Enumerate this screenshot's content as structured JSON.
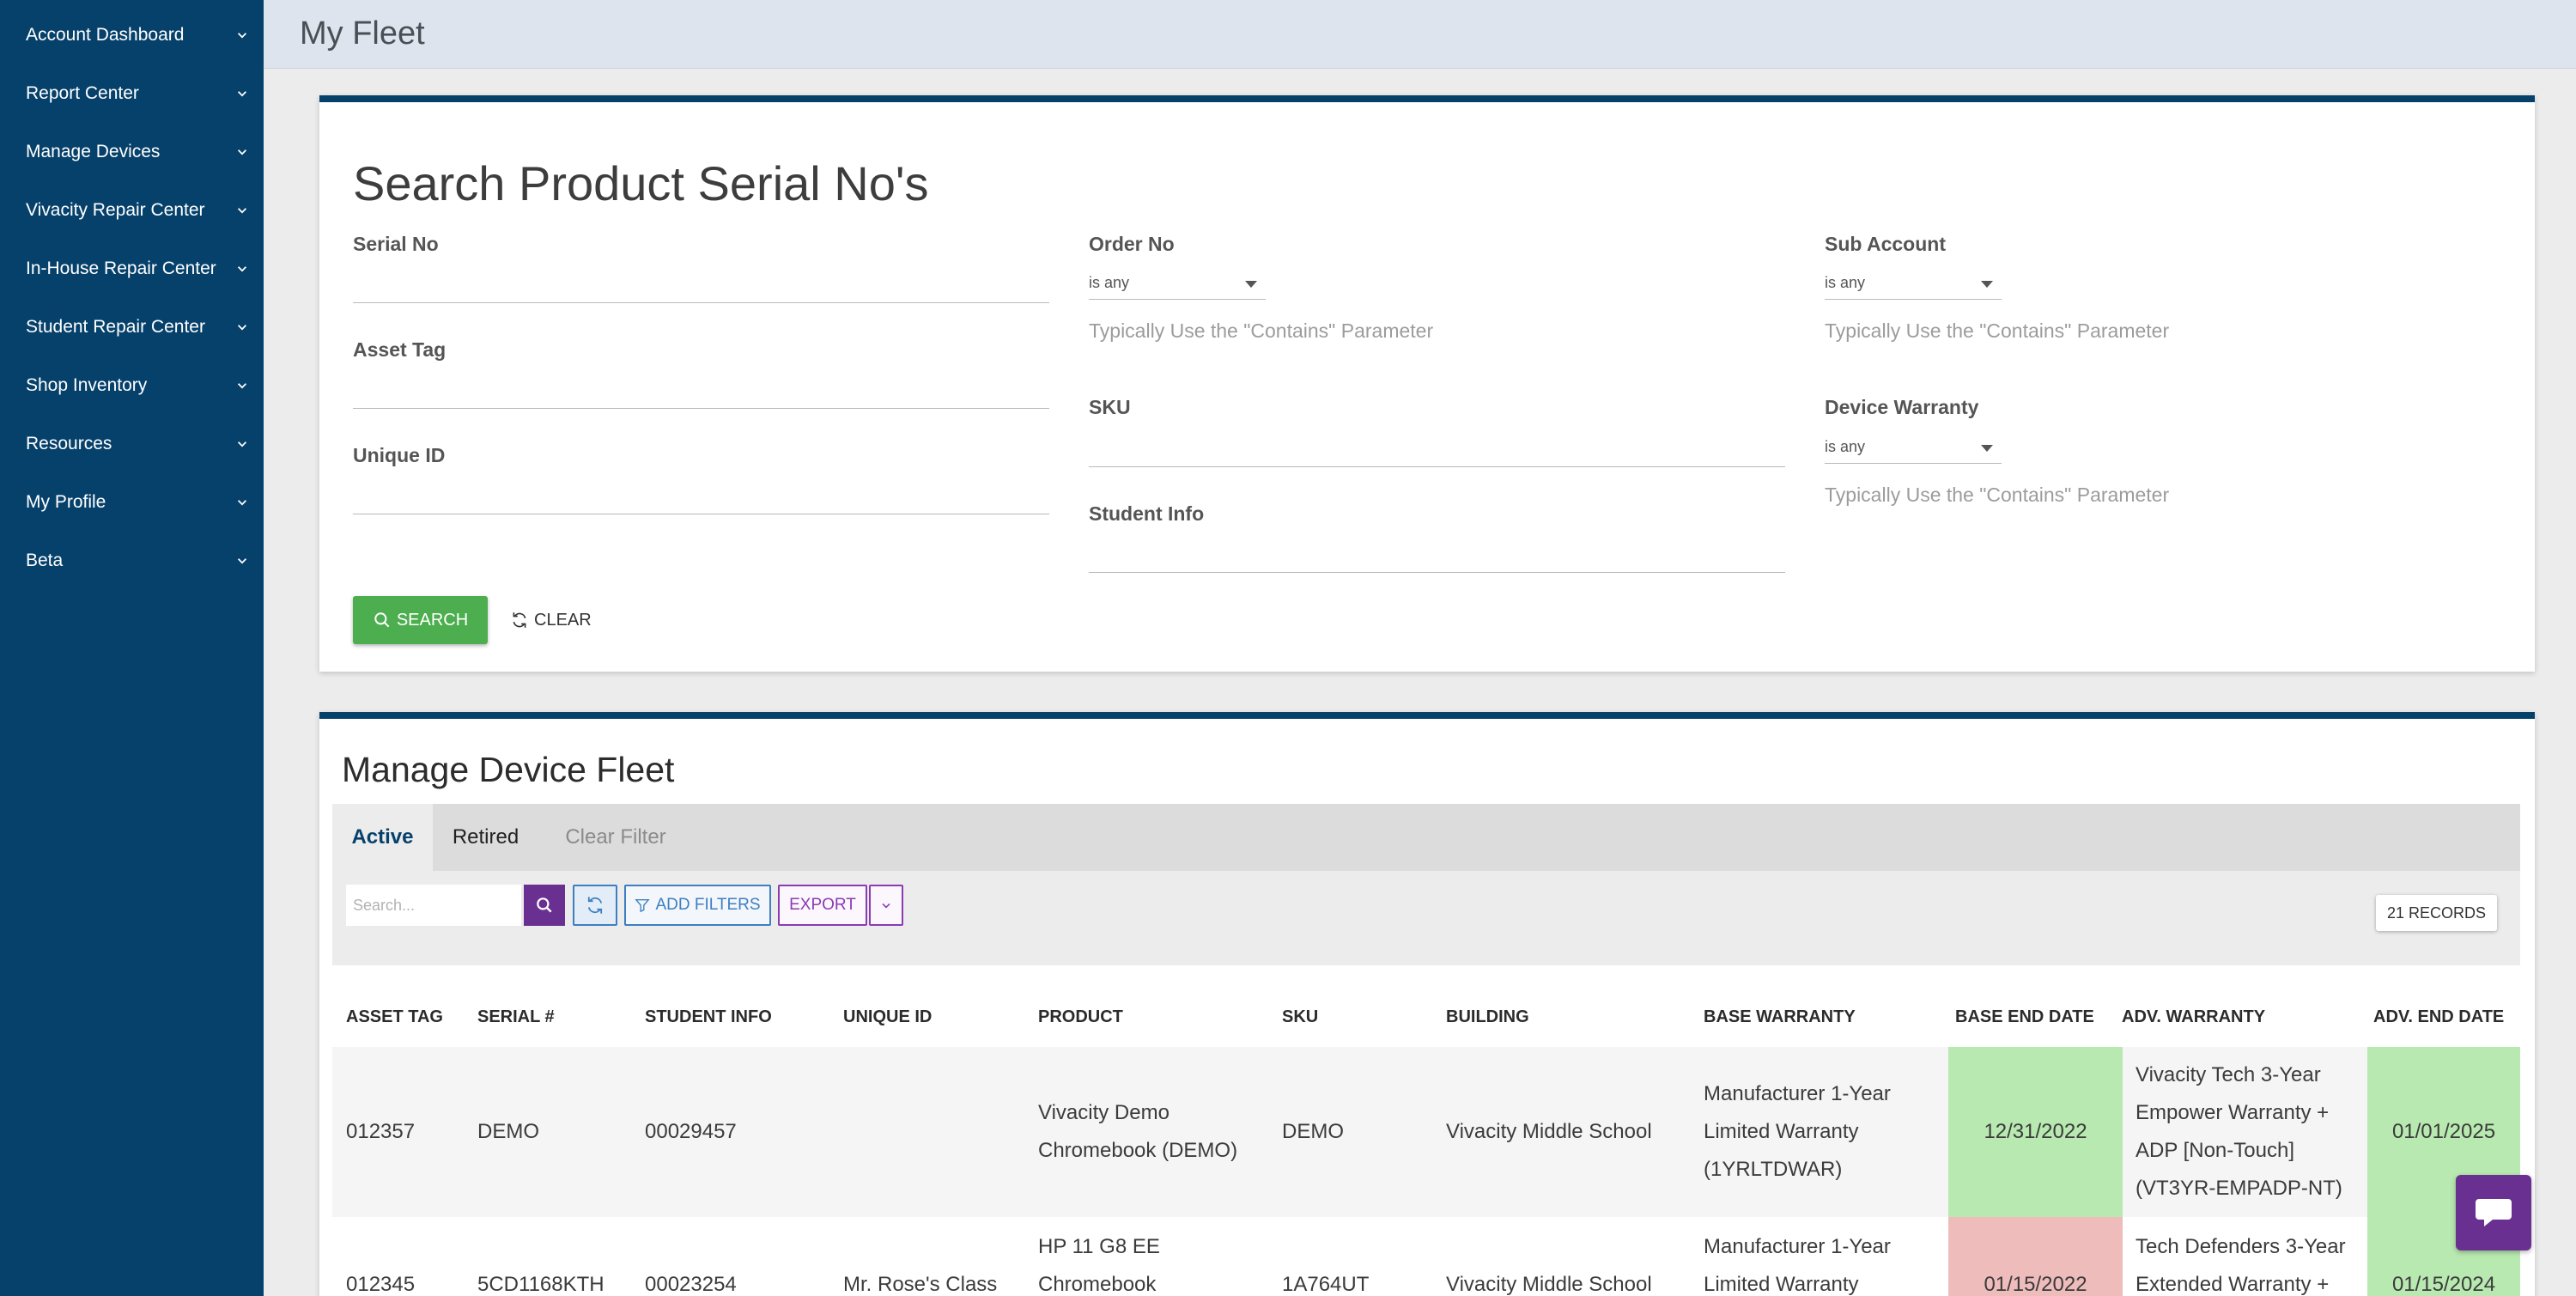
{
  "sidebar": {
    "items": [
      {
        "label": "Account Dashboard"
      },
      {
        "label": "Report Center"
      },
      {
        "label": "Manage Devices"
      },
      {
        "label": "Vivacity Repair Center"
      },
      {
        "label": "In-House Repair Center"
      },
      {
        "label": "Student Repair Center"
      },
      {
        "label": "Shop Inventory"
      },
      {
        "label": "Resources"
      },
      {
        "label": "My Profile"
      },
      {
        "label": "Beta"
      }
    ]
  },
  "header": {
    "title": "My Fleet"
  },
  "search": {
    "title": "Search Product Serial No's",
    "serial_no_label": "Serial No",
    "asset_tag_label": "Asset Tag",
    "unique_id_label": "Unique ID",
    "order_no_label": "Order No",
    "order_no_select": "is any",
    "order_no_hint": "Typically Use the \"Contains\" Parameter",
    "sku_label": "SKU",
    "student_info_label": "Student Info",
    "sub_account_label": "Sub Account",
    "sub_account_select": "is any",
    "sub_account_hint": "Typically Use the \"Contains\" Parameter",
    "device_warranty_label": "Device Warranty",
    "device_warranty_select": "is any",
    "device_warranty_hint": "Typically Use the \"Contains\" Parameter",
    "search_button": "SEARCH",
    "clear_button": "CLEAR"
  },
  "fleet": {
    "title": "Manage Device Fleet",
    "tabs": [
      "Active",
      "Retired",
      "Clear Filter"
    ],
    "search_placeholder": "Search...",
    "add_filters": "ADD FILTERS",
    "export": "EXPORT",
    "records": "21 RECORDS",
    "columns": [
      "ASSET TAG",
      "SERIAL #",
      "STUDENT INFO",
      "UNIQUE ID",
      "PRODUCT",
      "SKU",
      "BUILDING",
      "BASE WARRANTY",
      "BASE END DATE",
      "ADV. WARRANTY",
      "ADV. END DATE"
    ],
    "rows": [
      {
        "asset_tag": "012357",
        "serial": "DEMO",
        "student_info": "00029457",
        "unique_id": "",
        "product": [
          "Vivacity Demo",
          "Chromebook (DEMO)"
        ],
        "sku": "DEMO",
        "building": "Vivacity Middle School",
        "base_warranty": [
          "Manufacturer 1-Year",
          "Limited Warranty",
          "(1YRLTDWAR)"
        ],
        "base_end_date": "12/31/2022",
        "adv_warranty": [
          "Vivacity Tech 3-Year",
          "Empower Warranty +",
          "ADP [Non-Touch]",
          "(VT3YR-EMPADP-NT)"
        ],
        "adv_end_date": "01/01/2025"
      },
      {
        "asset_tag": "012345",
        "serial": "5CD1168KTH",
        "student_info": "00023254",
        "unique_id": "Mr. Rose's Class",
        "product": [
          "HP 11 G8 EE",
          "Chromebook"
        ],
        "sku": "1A764UT",
        "building": "Vivacity Middle School",
        "base_warranty": [
          "Manufacturer 1-Year",
          "Limited Warranty"
        ],
        "base_end_date": "01/15/2022",
        "adv_warranty": [
          "Tech Defenders 3-Year",
          "Extended Warranty +"
        ],
        "adv_end_date": "01/15/2024"
      }
    ]
  },
  "colors": {
    "sidebar": "#06416b",
    "success": "#4cae4f",
    "purple": "#6a3091",
    "status_ok": "#b8e9b0",
    "status_expired": "#efbcbc"
  }
}
